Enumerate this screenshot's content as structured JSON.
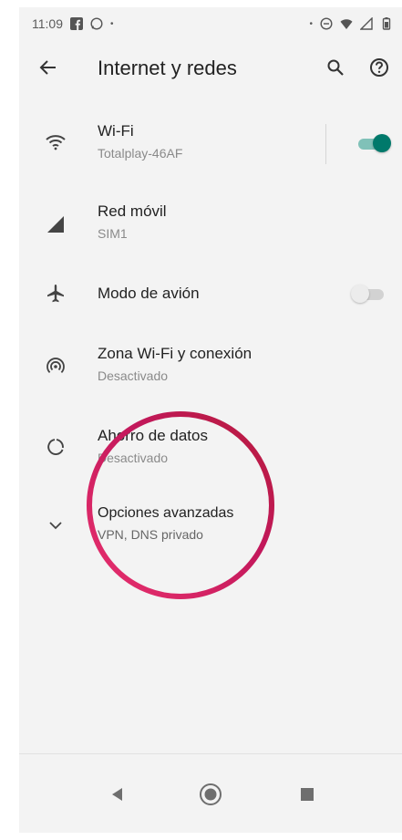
{
  "status_bar": {
    "time": "11:09",
    "left_icons": [
      "facebook-icon",
      "whatsapp-icon"
    ],
    "right_icons": [
      "dot-icon",
      "do-not-disturb-icon",
      "wifi-icon",
      "signal-icon",
      "battery-icon"
    ]
  },
  "app_bar": {
    "title": "Internet y redes",
    "back_icon": "arrow-back-icon",
    "search_icon": "search-icon",
    "help_icon": "help-icon"
  },
  "settings": [
    {
      "icon": "wifi-icon",
      "title": "Wi-Fi",
      "subtitle": "Totalplay-46AF",
      "toggle": true,
      "toggle_on": true
    },
    {
      "icon": "signal-icon",
      "title": "Red móvil",
      "subtitle": "SIM1"
    },
    {
      "icon": "airplane-icon",
      "title": "Modo de avión",
      "subtitle": "",
      "toggle": true,
      "toggle_on": false
    },
    {
      "icon": "hotspot-icon",
      "title": "Zona Wi-Fi y conexión",
      "subtitle": "Desactivado"
    },
    {
      "icon": "data-saver-icon",
      "title": "Ahorro de datos",
      "subtitle": "Desactivado"
    },
    {
      "icon": "chevron-down-icon",
      "title": "Opciones avanzadas",
      "subtitle": "VPN, DNS privado"
    }
  ],
  "colors": {
    "accent": "#00796b",
    "accent_track": "#80c1b8",
    "toggle_off_thumb": "#ececec",
    "toggle_off_track": "#bdbdbd",
    "highlight_circle_start": "#c21e56",
    "highlight_circle_end": "#e8306e"
  },
  "nav_bar": {
    "back_icon": "triangle-back-icon",
    "home_icon": "home-circle-icon",
    "recents_icon": "square-recents-icon"
  }
}
